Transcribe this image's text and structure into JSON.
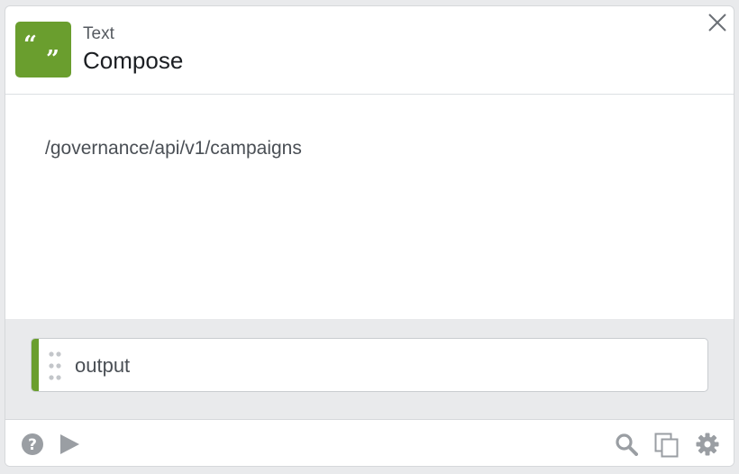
{
  "header": {
    "category": "Text",
    "title": "Compose",
    "app_icon": "quote-marks-icon",
    "accent_color": "#6a9e2e"
  },
  "body": {
    "text": "/governance/api/v1/campaigns"
  },
  "output": {
    "label": "output"
  },
  "footer": {
    "left_icons": [
      "help-icon",
      "play-icon"
    ],
    "right_icons": [
      "search-icon",
      "copy-icon",
      "gear-icon"
    ]
  }
}
